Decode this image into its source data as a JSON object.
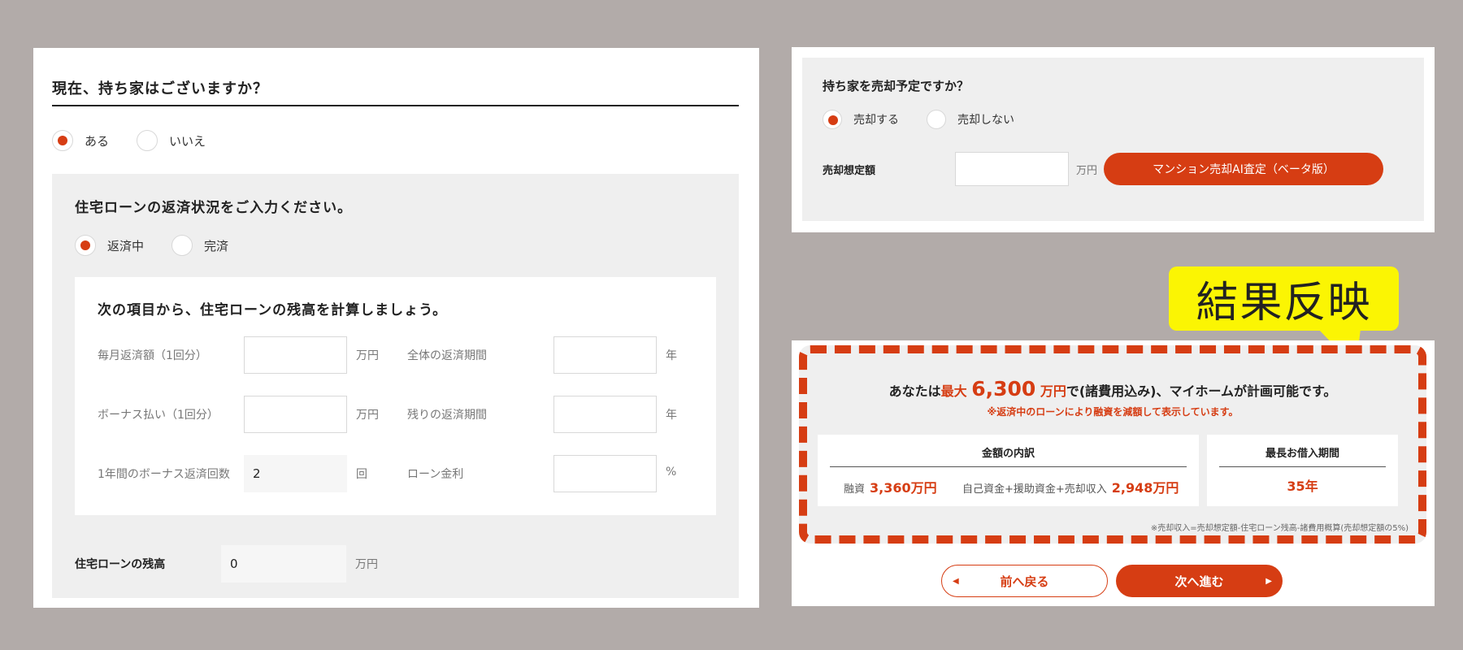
{
  "left": {
    "question": "現在、持ち家はございますか？",
    "own_home_options": [
      {
        "label": "ある",
        "selected": true
      },
      {
        "label": "いいえ",
        "selected": false
      }
    ],
    "loan_status_title": "住宅ローンの返済状況をご入力ください。",
    "loan_status_options": [
      {
        "label": "返済中",
        "selected": true
      },
      {
        "label": "完済",
        "selected": false
      }
    ],
    "calc_title": "次の項目から、住宅ローンの残高を計算しましょう。",
    "fields": {
      "monthly_label": "毎月返済額（1回分）",
      "monthly_value": "",
      "monthly_unit": "万円",
      "total_period_label": "全体の返済期間",
      "total_period_value": "",
      "total_period_unit": "年",
      "bonus_label": "ボーナス払い（1回分）",
      "bonus_value": "",
      "bonus_unit": "万円",
      "remaining_period_label": "残りの返済期間",
      "remaining_period_value": "",
      "remaining_period_unit": "年",
      "bonus_count_label": "1年間のボーナス返済回数",
      "bonus_count_value": "2",
      "bonus_count_unit": "回",
      "rate_label": "ローン金利",
      "rate_value": "",
      "rate_unit": "%"
    },
    "balance_label": "住宅ローンの残高",
    "balance_value": "0",
    "balance_unit": "万円"
  },
  "right_top": {
    "question": "持ち家を売却予定ですか？",
    "sell_options": [
      {
        "label": "売却する",
        "selected": true
      },
      {
        "label": "売却しない",
        "selected": false
      }
    ],
    "sale_price_label": "売却想定額",
    "sale_price_value": "",
    "sale_price_unit": "万円",
    "ai_button": "マンション売却AI査定（ベータ版）"
  },
  "callout": "結果反映",
  "result": {
    "prefix": "あなたは",
    "max_label": "最大",
    "amount": "6,300",
    "unit": "万円",
    "suffix": "で(諸費用込み)、マイホームが計画可能です。",
    "note": "※返済中のローンにより融資を減額して表示しています。",
    "breakdown_title": "金額の内訳",
    "loan_label": "融資",
    "loan_value": "3,360万円",
    "own_funds_label": "自己資金+援助資金+売却収入",
    "own_funds_value": "2,948万円",
    "period_title": "最長お借入期間",
    "period_value": "35年",
    "footnote": "※売却収入=売却想定額-住宅ローン残高-諸費用概算(売却想定額の5%)"
  },
  "nav": {
    "back": "前へ戻る",
    "next": "次へ進む"
  },
  "colors": {
    "accent": "#d63d13",
    "background": "#b2aba9",
    "callout": "#fbf503",
    "panel_gray": "#efefef"
  }
}
